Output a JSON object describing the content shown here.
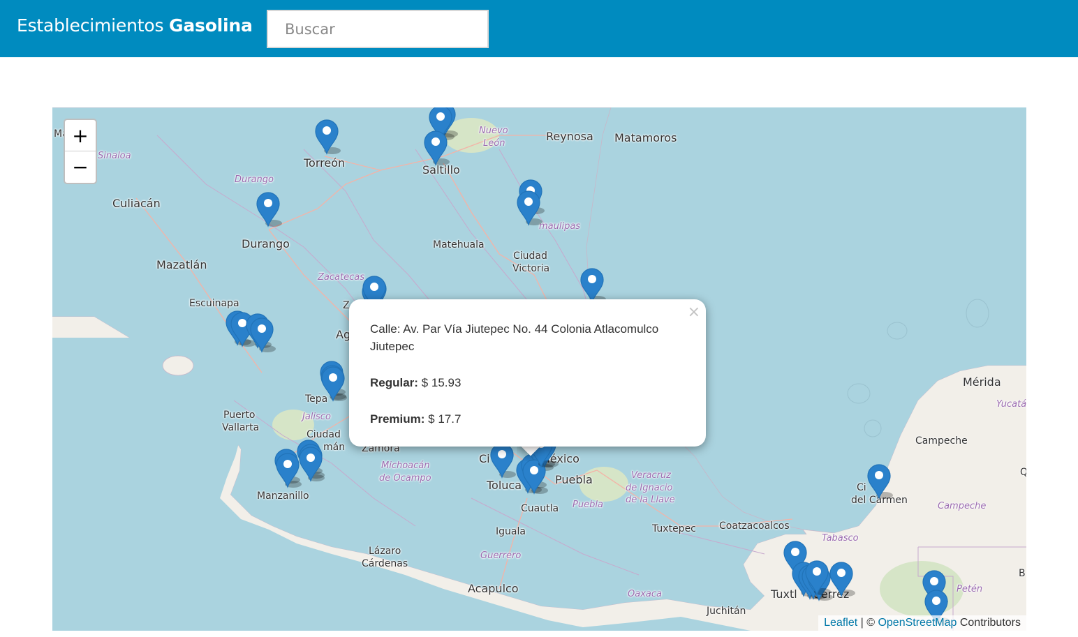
{
  "navbar": {
    "brand_light": "Establecimientos",
    "brand_bold": "Gasolina",
    "search_placeholder": "Buscar"
  },
  "map": {
    "colors": {
      "sea": "#aad3df",
      "land": "#f2efe9",
      "header": "#008bbf",
      "marker": "#2a81cb"
    },
    "cities": [
      "Torreón",
      "Saltillo",
      "Reynosa",
      "Matamoros",
      "Culiacán",
      "Durango",
      "Mazatlán",
      "Matehuala",
      "Ciudad",
      "Victoria",
      "Escuinapa",
      "Puerto",
      "Vallarta",
      "Manzanillo",
      "Zamora",
      "Toluca",
      "México",
      "Puebla",
      "Cuautla",
      "Iguala",
      "Lázaro",
      "Cárdenas",
      "Acapulco",
      "Tuxtepec",
      "Coatzacoalcos",
      "Mérida",
      "Campeche",
      "Juchitán",
      "Tepa",
      "Ag",
      "Ciudad",
      "mán",
      "Ci",
      "Z",
      "Tuxtl",
      "tiérrez",
      "Ci",
      "del Carmen",
      "Ma",
      "B",
      "Q"
    ],
    "states": [
      "Sinaloa",
      "Durango",
      "Nuevo",
      "León",
      "Zacatecas",
      "maulipas",
      "Jalisco",
      "Michoacán",
      "de Ocampo",
      "Veracruz",
      "de Ignacio",
      "de la Llave",
      "Puebla",
      "Guerrero",
      "Oaxaca",
      "Tabasco",
      "Campeche",
      "Yucatá",
      "Petén"
    ],
    "zoom": {
      "in": "+",
      "out": "−"
    },
    "attribution": {
      "leaflet": "Leaflet",
      "sep": " | © ",
      "osm": "OpenStreetMap",
      "contrib": " Contributors"
    },
    "popup": {
      "address": "Calle: Av. Par Vía Jiutepec No. 44 Colonia Atlacomulco Jiutepec",
      "regular_label": "Regular:",
      "regular_value": " $ 15.93",
      "premium_label": "Premium:",
      "premium_value": " $ 17.7",
      "close": "×"
    },
    "marker_count": 40
  }
}
